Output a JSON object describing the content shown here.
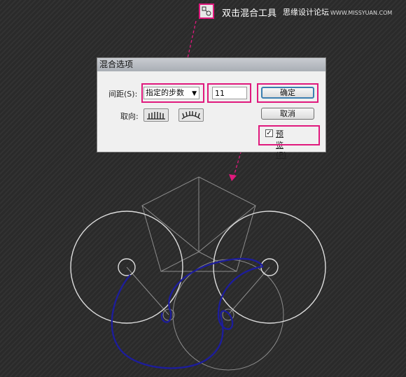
{
  "toolbar": {
    "tool_icon": "blend-tool-icon",
    "tool_label": "双击混合工具",
    "watermark_main": "思缘设计论坛",
    "watermark_sub": "WWW.MISSYUAN.COM"
  },
  "dialog": {
    "title": "混合选项",
    "spacing_label": "间距(S):",
    "spacing_selected": "指定的步数",
    "steps_value": "11",
    "orientation_label": "取向:",
    "ok_label": "确定",
    "cancel_label": "取消",
    "preview_label": "预览(P)",
    "preview_checked": true
  },
  "colors": {
    "annotation": "#e0197d",
    "blend_curve": "#1d1d9a",
    "shape_stroke": "#dddddd",
    "guide_stroke": "#8c8c8c"
  }
}
